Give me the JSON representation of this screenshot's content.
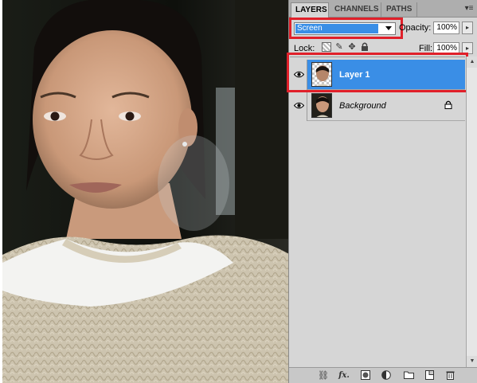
{
  "panel": {
    "tabs": [
      {
        "label": "LAYERS",
        "active": true
      },
      {
        "label": "CHANNELS",
        "active": false
      },
      {
        "label": "PATHS",
        "active": false
      }
    ],
    "blend_mode": "Screen",
    "opacity_label": "Opacity:",
    "opacity_value": "100%",
    "lock_label": "Lock:",
    "fill_label": "Fill:",
    "fill_value": "100%",
    "layers": [
      {
        "name": "Layer 1",
        "selected": true,
        "visible": true,
        "locked": false
      },
      {
        "name": "Background",
        "selected": false,
        "visible": true,
        "locked": true
      }
    ]
  },
  "icons": {
    "menu": "panel-menu-icon",
    "eye": "eye-icon",
    "lock": "lock-icon",
    "link": "link-layers-icon",
    "fx": "fx-icon",
    "mask": "add-mask-icon",
    "adjustment": "adjustment-layer-icon",
    "group": "folder-icon",
    "new_layer": "new-layer-icon",
    "delete": "trash-icon"
  },
  "colors": {
    "selection_blue": "#3a8ee6",
    "annotation_red": "#e0202a",
    "panel_gray": "#d6d6d6"
  }
}
